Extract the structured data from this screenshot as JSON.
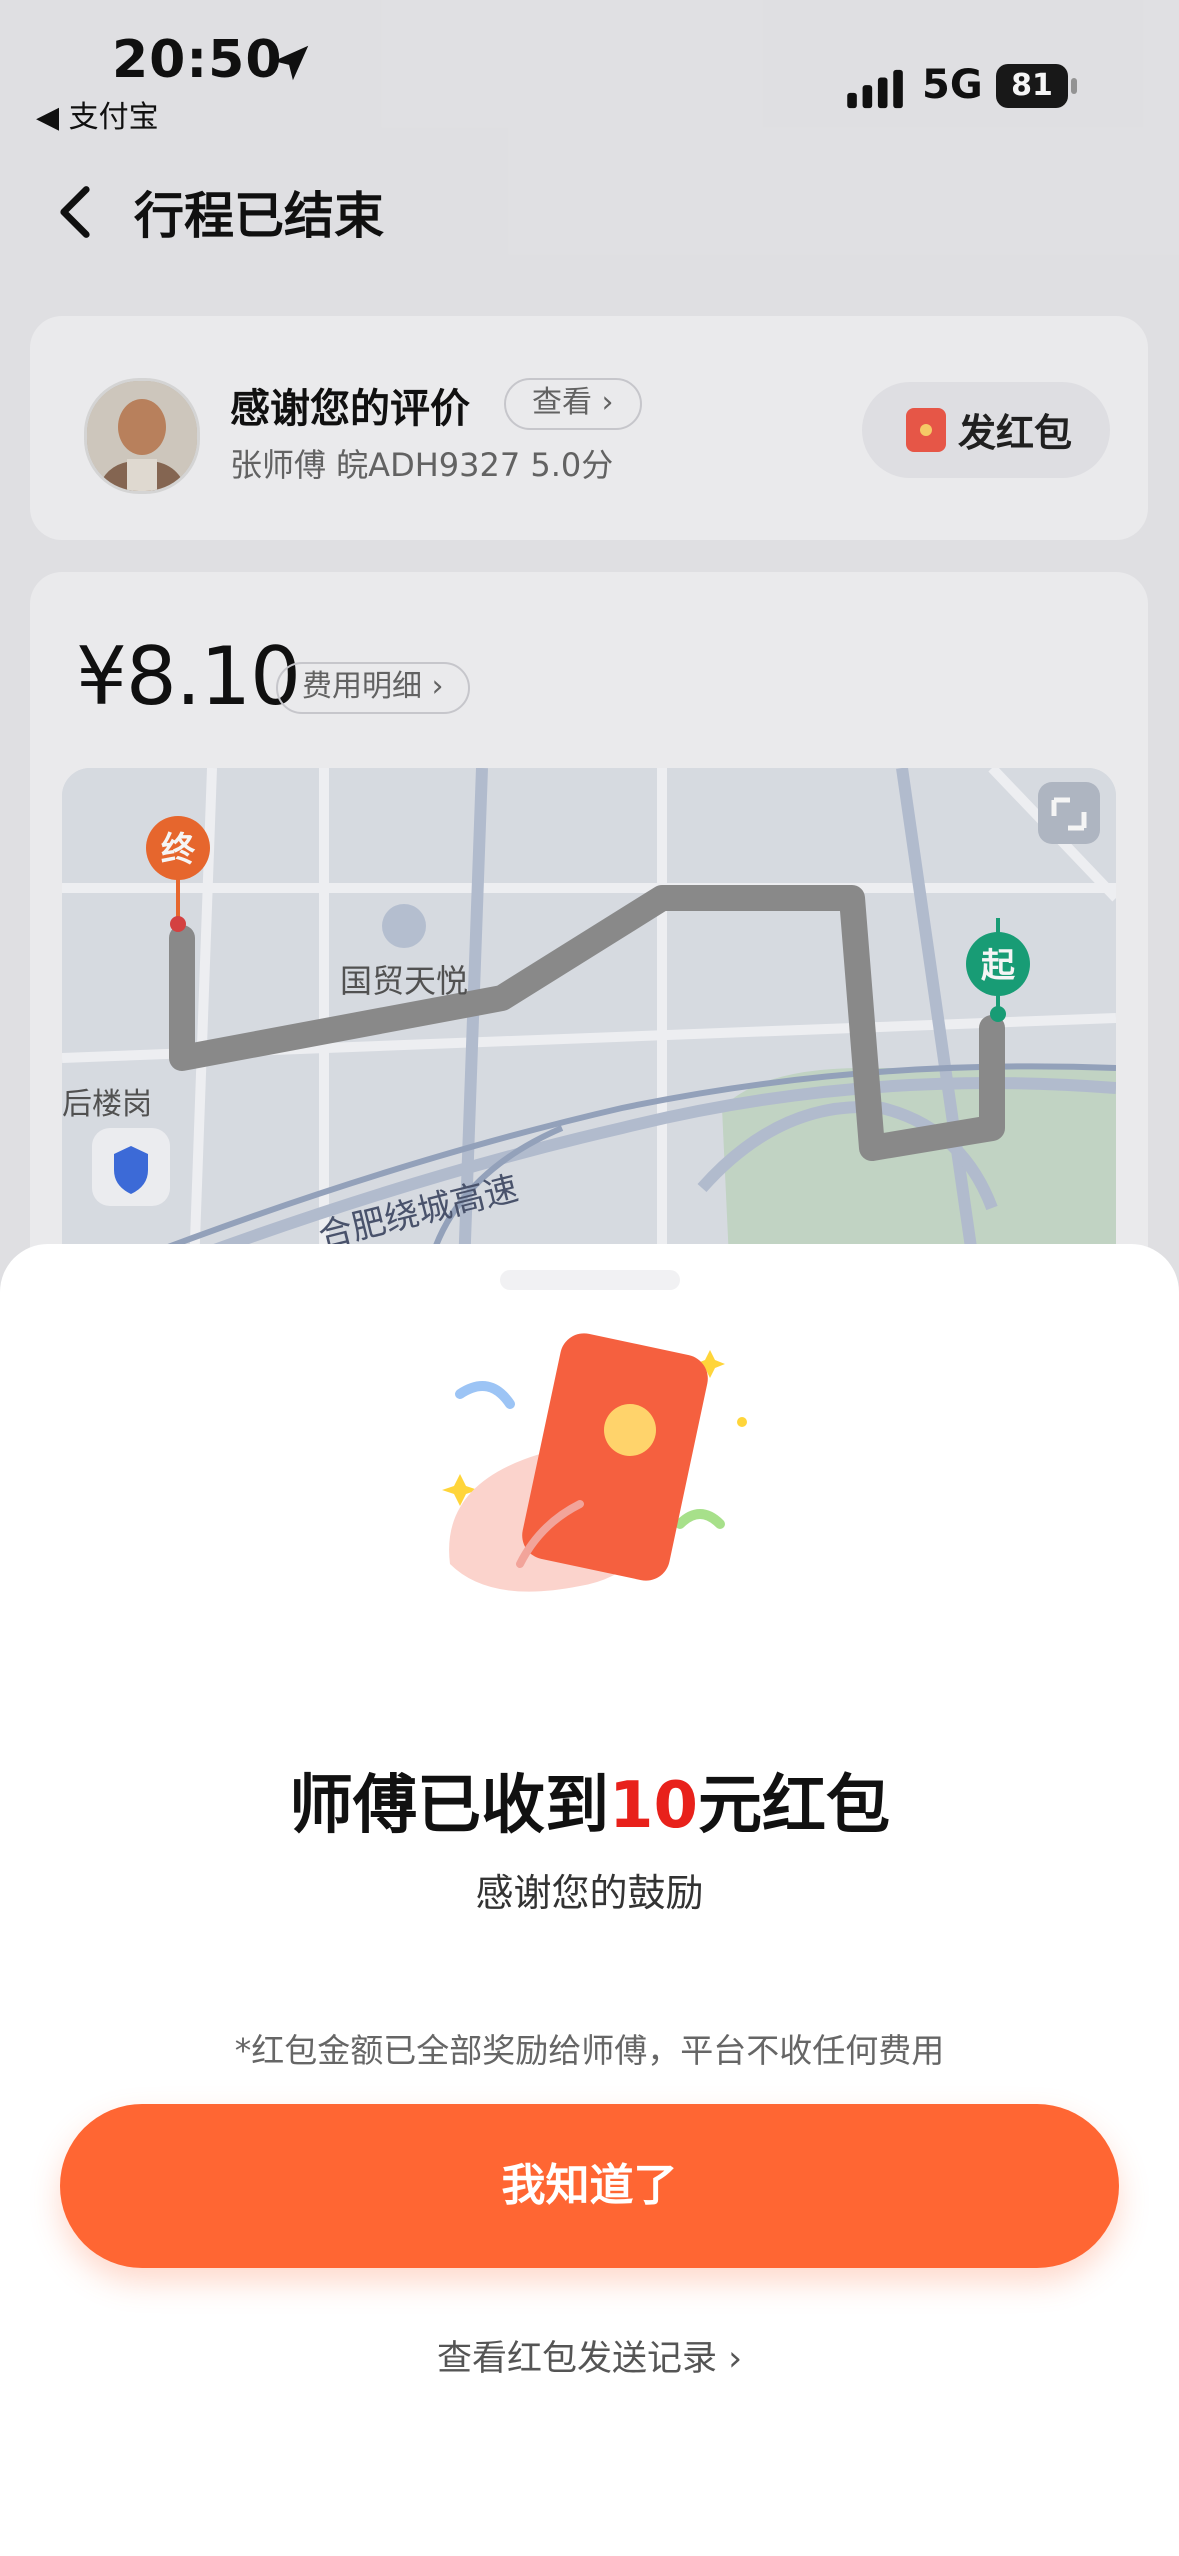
{
  "status_bar": {
    "time": "20:50",
    "back_app": "◀ 支付宝",
    "network": "5G",
    "battery": "81"
  },
  "nav": {
    "title": "行程已结束"
  },
  "driver_card": {
    "thanks": "感谢您的评价",
    "view": "查看 ›",
    "driver_info": "张师傅 皖ADH9327 5.0分",
    "hongbao_button": "发红包"
  },
  "trip_card": {
    "price": "¥8.10",
    "fee_detail": "费用明细 ›",
    "map": {
      "end_marker": "终",
      "start_marker": "起",
      "poi": "国贸天悦",
      "road": "合肥绕城高速",
      "district": "后楼岗"
    }
  },
  "sheet": {
    "headline_prefix": "师傅已收到",
    "headline_amount": "10",
    "headline_suffix": "元红包",
    "subtitle": "感谢您的鼓励",
    "note": "*红包金额已全部奖励给师傅，平台不收任何费用",
    "ok_button": "我知道了",
    "records_link": "查看红包发送记录 ›"
  },
  "colors": {
    "accent": "#ff6633",
    "amount": "#e8211b",
    "route": "#8f8f8f",
    "end_marker": "#f06b2f",
    "start_marker": "#1aa37a"
  }
}
